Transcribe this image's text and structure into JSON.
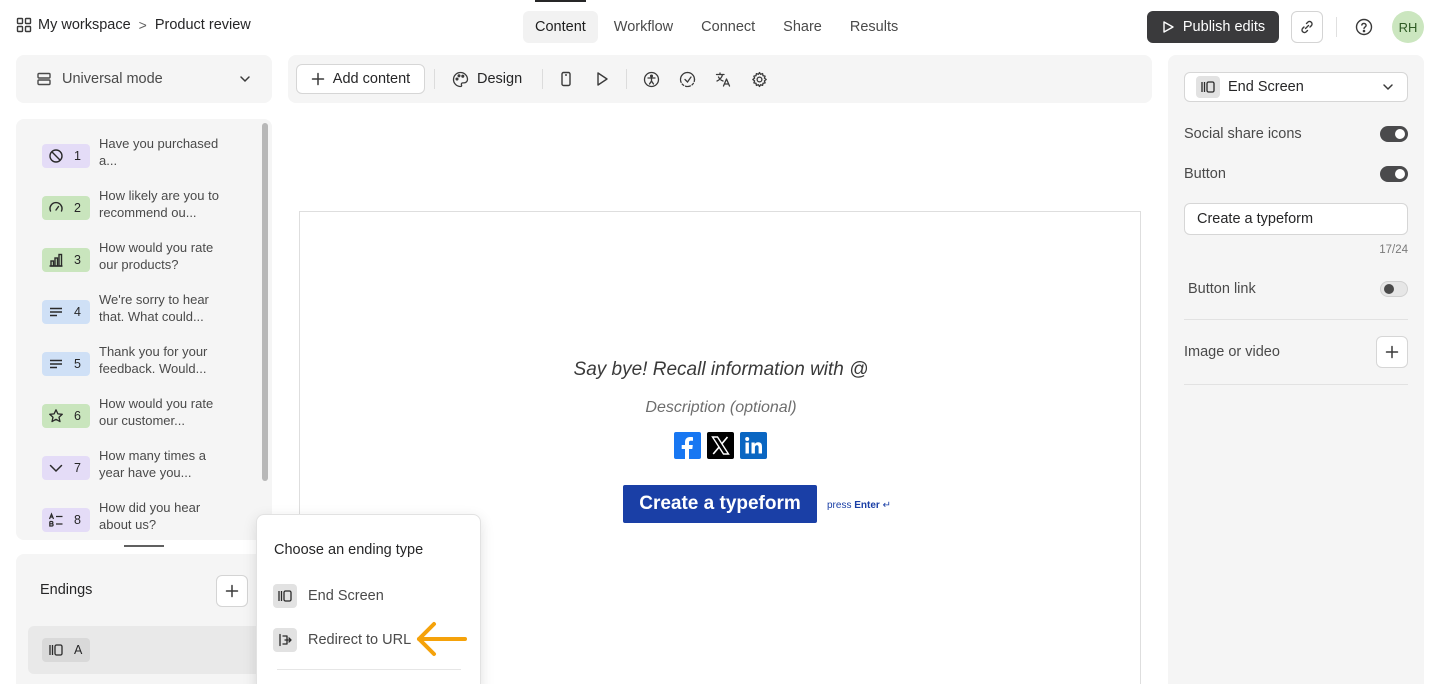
{
  "breadcrumb": {
    "workspace": "My workspace",
    "separator": ">",
    "form": "Product review"
  },
  "tabs": [
    {
      "label": "Content",
      "active": true
    },
    {
      "label": "Workflow"
    },
    {
      "label": "Connect"
    },
    {
      "label": "Share"
    },
    {
      "label": "Results"
    }
  ],
  "header": {
    "publish_label": "Publish edits",
    "avatar_initials": "RH"
  },
  "mode": {
    "label": "Universal mode"
  },
  "questions": [
    {
      "num": "1",
      "text": "Have you purchased a...",
      "icon": "slash-circle-icon",
      "color": "#e4dcf7"
    },
    {
      "num": "2",
      "text": "How likely are you to recommend ou...",
      "icon": "gauge-icon",
      "color": "#c9e5bd"
    },
    {
      "num": "3",
      "text": "How would you rate our products?",
      "icon": "bar-chart-icon",
      "color": "#c9e5bd"
    },
    {
      "num": "4",
      "text": "We're sorry to hear that. What could...",
      "icon": "text-lines-icon",
      "color": "#cfe0f6"
    },
    {
      "num": "5",
      "text": "Thank you for your feedback. Would...",
      "icon": "text-lines-icon",
      "color": "#cfe0f6"
    },
    {
      "num": "6",
      "text": "How would you rate our customer...",
      "icon": "star-icon",
      "color": "#c9e5bd"
    },
    {
      "num": "7",
      "text": "How many times a year have you...",
      "icon": "chevron-down-icon",
      "color": "#e4dcf7"
    },
    {
      "num": "8",
      "text": "How did you hear about us?",
      "icon": "ab-list-icon",
      "color": "#e4dcf7"
    }
  ],
  "endings": {
    "label": "Endings",
    "item_letter": "A"
  },
  "toolbar": {
    "add_content": "Add content",
    "design": "Design"
  },
  "canvas": {
    "title": "Say bye! Recall information with @",
    "description": "Description (optional)",
    "cta": "Create a typeform",
    "press": "press",
    "enter": "Enter",
    "enter_symbol": "↵"
  },
  "popup": {
    "heading": "Choose an ending type",
    "options": [
      {
        "label": "End Screen"
      },
      {
        "label": "Redirect to URL"
      }
    ]
  },
  "right": {
    "select_label": "End Screen",
    "social_label": "Social share icons",
    "button_label": "Button",
    "button_text": "Create a typeform",
    "count": "17/24",
    "button_link_label": "Button link",
    "media_label": "Image or video"
  },
  "colors": {
    "accent": "#1a3fa6",
    "annotation_arrow": "#f5a20a"
  }
}
